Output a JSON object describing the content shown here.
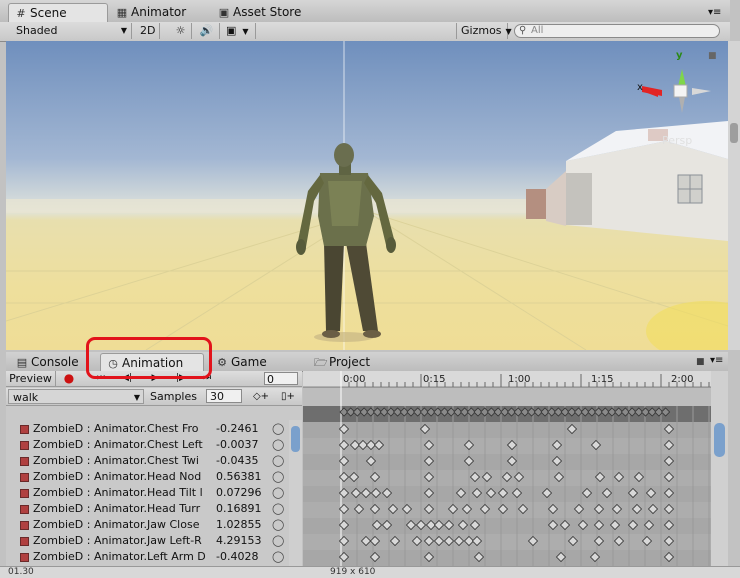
{
  "top_tabs": [
    {
      "label": "Scene",
      "icon": "grid-icon"
    },
    {
      "label": "Animator",
      "icon": "animator-icon"
    },
    {
      "label": "Asset Store",
      "icon": "store-icon"
    }
  ],
  "scene_toolbar": {
    "shading": "Shaded",
    "mode_2d": "2D",
    "gizmos": "Gizmos",
    "search_placeholder": "All"
  },
  "gizmo": {
    "x_label": "x",
    "y_label": "y",
    "persp_label": "Persp"
  },
  "bottom_tabs": [
    {
      "label": "Console",
      "icon": "console-icon"
    },
    {
      "label": "Animation",
      "icon": "clock-icon"
    },
    {
      "label": "Game",
      "icon": "game-icon"
    },
    {
      "label": "Project",
      "icon": "folder-icon"
    }
  ],
  "animation": {
    "preview_label": "Preview",
    "frame": "0",
    "clip": "walk",
    "samples_label": "Samples",
    "samples": "30",
    "timeline_labels": [
      "0:00",
      "0:15",
      "1:00",
      "1:15",
      "2:00"
    ],
    "properties": [
      {
        "name": "ZombieD : Animator.Chest Fro",
        "value": "-0.2461"
      },
      {
        "name": "ZombieD : Animator.Chest Left",
        "value": "-0.0037"
      },
      {
        "name": "ZombieD : Animator.Chest Twi",
        "value": "-0.0435"
      },
      {
        "name": "ZombieD : Animator.Head Nod",
        "value": "0.56381"
      },
      {
        "name": "ZombieD : Animator.Head Tilt l",
        "value": "0.07296"
      },
      {
        "name": "ZombieD : Animator.Head Turr",
        "value": "0.16891"
      },
      {
        "name": "ZombieD : Animator.Jaw Close",
        "value": "1.02855"
      },
      {
        "name": "ZombieD : Animator.Jaw Left-R",
        "value": "4.29153"
      },
      {
        "name": "ZombieD : Animator.Left Arm D",
        "value": "-0.4028"
      }
    ]
  },
  "status_bar": {
    "left": "01.30",
    "right": "919 x 610"
  },
  "colors": {
    "highlight": "#e2131b",
    "record": "#cc1111",
    "keyframe": "#d8d8d8"
  }
}
